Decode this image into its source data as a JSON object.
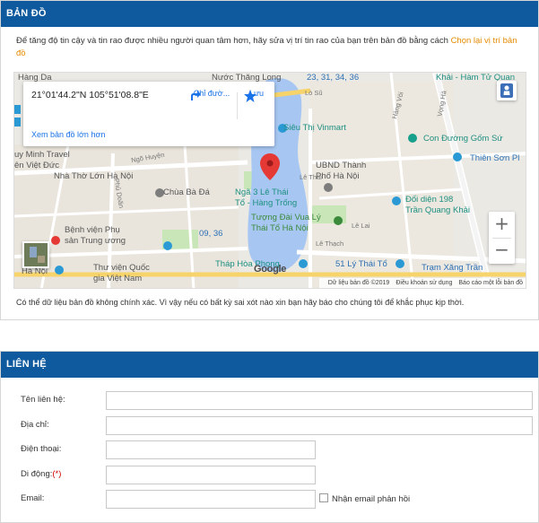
{
  "map_section": {
    "title": "BẢN ĐỒ",
    "intro_text": "Để tăng độ tin cậy và tin rao được nhiều người quan tâm hơn, hãy sửa vị trí tin rao của bạn trên bản đồ bằng cách ",
    "intro_link": "Chọn lại vị trí bản đồ",
    "info_card": {
      "coordinates": "21°01'44.2\"N 105°51'08.8\"E",
      "directions_label": "Chỉ đườ...",
      "save_label": "Lưu",
      "larger_map_link": "Xem bản đồ lớn hơn"
    },
    "map_labels": {
      "hang_do": "Hàng Da",
      "nuoc_thang_long": "Nước Thăng Long",
      "address_23": "23, 31, 34, 36",
      "khai_ham": "Khải - Hàm Tử Quan",
      "sieu_thi": "Siêu Thị Vinmart",
      "con_duong": "Con Đường Gốm Sứ",
      "minh_travel": "uy Minh Travel",
      "viet_duc": "ên Việt Đức",
      "ubnd": "UBND Thành\nPhố Hà Nội",
      "thien_son": "Thiên Sơn Pl",
      "nha_tho": "Nhà Thờ Lớn Hà Nội",
      "chua_ba_da": "Chùa Bà Đá",
      "nga_3": "Ngã 3 Lê Thái\nTổ - Hàng Trống",
      "doi_dien": "Đối diện 198\nTrần Quang Khải",
      "tuong_dai": "Tượng Đài Vua Lý\nThái Tổ Hà Nội",
      "benh_vien": "Bệnh viện Phụ\nsản Trung ương",
      "address_09": "09, 36",
      "le_thach": "Lê Thạch",
      "ha_noi": "Hà Nội",
      "thu_vien": "Thư viện Quốc\ngia Việt Nam",
      "thap_hoa_phong": "Tháp Hòa Phong",
      "ly_thai_to": "51 Lý Thái Tổ",
      "tram_xang": "Trạm Xăng Trần",
      "le_lai": "Lê Lai",
      "lo_su": "Lò Sũ",
      "hang_ve": "Hàng Vôi",
      "le_thai": "Lê Thái",
      "ngo_huyen": "Ngõ Huyện",
      "phu_doan": "Phủ Doãn",
      "vong_ha": "Vọng Hà"
    },
    "google_logo": "Google",
    "attribution": {
      "data": "Dữ liệu bản đồ ©2019",
      "terms": "Điều khoản sử dụng",
      "report": "Báo cáo một lỗi bản đồ"
    },
    "disclaimer": "Có thể dữ liệu bản đồ không chính xác. Vì vậy nếu có bất kỳ sai xót nào xin bạn hãy báo cho chúng tôi để khắc phục kịp thời."
  },
  "contact_section": {
    "title": "LIÊN HỆ",
    "fields": {
      "name_label": "Tên liên hệ:",
      "address_label": "Địa chỉ:",
      "phone_label": "Điện thoại:",
      "mobile_label": "Di động:",
      "mobile_required": "(*)",
      "email_label": "Email:",
      "email_opt_label": "Nhận email phản hồi"
    }
  }
}
